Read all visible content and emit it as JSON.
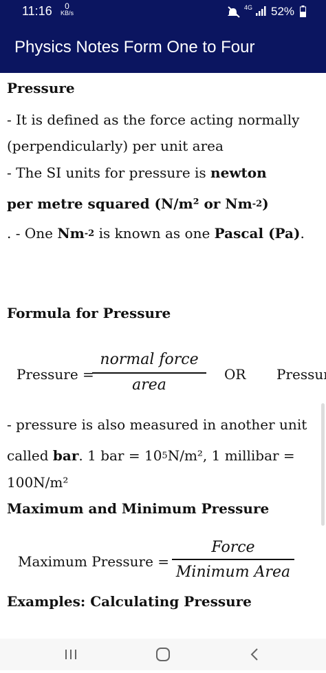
{
  "status_bar": {
    "time": "11:16",
    "netspeed_value": "0",
    "netspeed_unit": "KB/s",
    "network": "4G",
    "battery": "52%"
  },
  "app_bar": {
    "title": "Physics Notes Form One to Four"
  },
  "article": {
    "heading": "Pressure",
    "def_line1": "- It is defined as the force acting normally",
    "def_line2": "(perpendicularly) per unit area",
    "si_prefix": "- The SI units for pressure is ",
    "si_bold1": "newton",
    "si_bold2a": "per metre squared (N/m² or Nm",
    "si_sup": "-2",
    "si_bold2b": ")",
    "pascal_prefix": ". - One ",
    "pascal_nm": "Nm",
    "pascal_sup": "-2",
    "pascal_mid": " is known as one ",
    "pascal_bold": "Pascal (Pa)",
    "pascal_suffix": ".",
    "formula_heading": "Formula for Pressure",
    "formula1_lhs": "Pressure =",
    "formula1_num": "normal force",
    "formula1_den": "area",
    "formula1_or": "OR",
    "formula1_cut": "Pressure",
    "bar_line1": "- pressure is also measured in another unit",
    "bar_prefix": "called ",
    "bar_bold": "bar",
    "bar_mid": ". 1 bar = 10",
    "bar_sup": "5",
    "bar_end": "N/m², 1 millibar =",
    "bar_line3": "100N/m²",
    "maxmin_heading": "Maximum and Minimum Pressure",
    "formula2_lhs": "Maximum Pressure =",
    "formula2_num": "Force",
    "formula2_den": "Minimum Area",
    "examples_heading": "Examples: Calculating Pressure"
  },
  "colors": {
    "app_bar": "#0b1560",
    "nav_bar": "#f7f7f7"
  },
  "nav_bar": {
    "icons": [
      "recent-apps-icon",
      "home-icon",
      "back-icon"
    ]
  }
}
